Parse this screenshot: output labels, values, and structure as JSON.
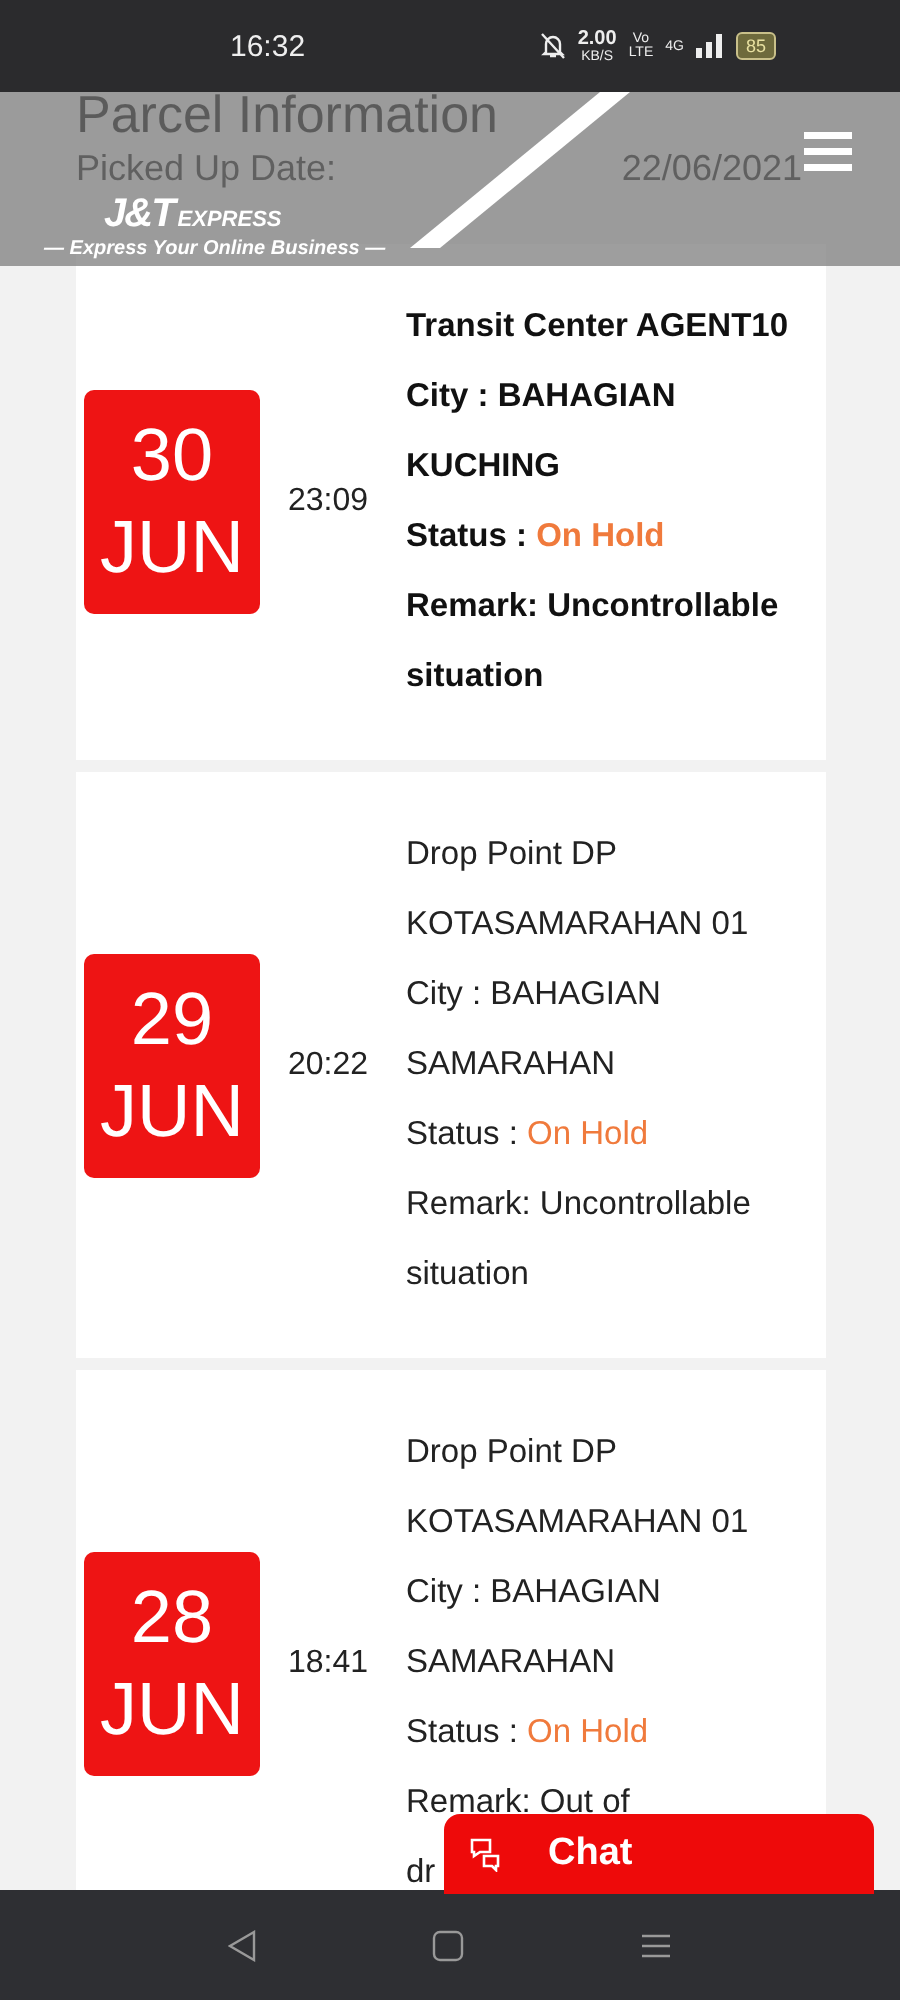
{
  "status_bar": {
    "time": "16:32",
    "speed": "2.00",
    "speed_unit": "KB/S",
    "volte_top": "Vo",
    "volte_bottom": "LTE",
    "network": "4G",
    "battery": "85"
  },
  "header": {
    "logo_mark": "J&T",
    "logo_word": "EXPRESS",
    "tagline": "— Express Your Online Business —"
  },
  "page": {
    "title": "Parcel Information",
    "picked_up_label": "Picked Up Date:",
    "picked_up_date": "22/06/2021"
  },
  "events": [
    {
      "day": "30",
      "month": "JUN",
      "time": "23:09",
      "latest": true,
      "location": "Transit Center AGENT10",
      "city": "City : BAHAGIAN KUCHING",
      "status_label": "Status : ",
      "status": "On Hold",
      "remark": "Remark: Uncontrollable situation"
    },
    {
      "day": "29",
      "month": "JUN",
      "time": "20:22",
      "latest": false,
      "location": "Drop Point DP KOTASAMARAHAN 01",
      "city": "City : BAHAGIAN SAMARAHAN",
      "status_label": "Status : ",
      "status": "On Hold",
      "remark": "Remark: Uncontrollable situation"
    },
    {
      "day": "28",
      "month": "JUN",
      "time": "18:41",
      "latest": false,
      "location": "Drop Point DP KOTASAMARAHAN 01",
      "city": "City : BAHAGIAN SAMARAHAN",
      "status_label": "Status : ",
      "status": "On Hold",
      "remark": "Remark: Out of\ndr"
    }
  ],
  "chat_button": {
    "label": "Chat"
  }
}
